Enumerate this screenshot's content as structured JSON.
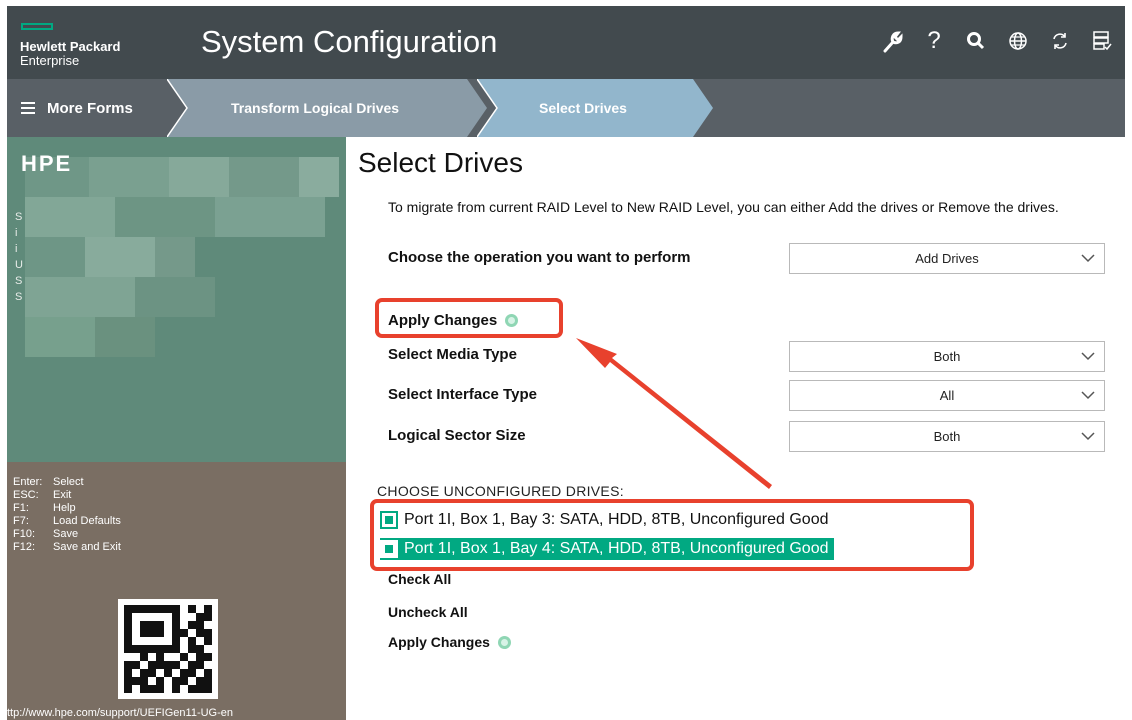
{
  "header": {
    "brand_line1": "Hewlett Packard",
    "brand_line2": "Enterprise",
    "title": "System Configuration",
    "icons": [
      "wrench-icon",
      "help-icon",
      "search-icon",
      "globe-icon",
      "refresh-icon",
      "server-icon"
    ]
  },
  "nav": {
    "more_forms": "More Forms",
    "breadcrumbs": [
      "Transform Logical Drives",
      "Select Drives"
    ]
  },
  "left_panel": {
    "title_fragment": "HPE",
    "side_letters": "S\ni\ni\nU\nS\nS",
    "keys": [
      {
        "key": "Enter:",
        "action": "Select"
      },
      {
        "key": "ESC:",
        "action": "Exit"
      },
      {
        "key": "F1:",
        "action": "Help"
      },
      {
        "key": "F7:",
        "action": "Load Defaults"
      },
      {
        "key": "F10:",
        "action": "Save"
      },
      {
        "key": "F12:",
        "action": "Save and Exit"
      }
    ],
    "url": "ttp://www.hpe.com/support/UEFIGen11-UG-en"
  },
  "main": {
    "title": "Select Drives",
    "description": "To migrate from current RAID Level to New RAID Level, you can either Add the drives or Remove the drives.",
    "operation_label": "Choose the operation you want to perform",
    "operation_value": "Add Drives",
    "apply_changes_label": "Apply Changes",
    "media_type_label": "Select Media Type",
    "media_type_value": "Both",
    "interface_type_label": "Select Interface Type",
    "interface_type_value": "All",
    "sector_size_label": "Logical Sector Size",
    "sector_size_value": "Both",
    "drives_heading": "CHOOSE UNCONFIGURED DRIVES:",
    "drives": [
      {
        "label": "Port 1I, Box 1, Bay 3: SATA, HDD, 8TB, Unconfigured Good",
        "checked": true
      },
      {
        "label": "Port 1I, Box 1, Bay 4: SATA, HDD, 8TB, Unconfigured Good",
        "checked": true
      }
    ],
    "check_all": "Check All",
    "uncheck_all": "Uncheck All",
    "apply_changes_bottom": "Apply Changes"
  },
  "colors": {
    "accent": "#01a982",
    "annotation_red": "#e8412d",
    "header_bg": "#424a4e",
    "nav_bg": "#596066"
  }
}
